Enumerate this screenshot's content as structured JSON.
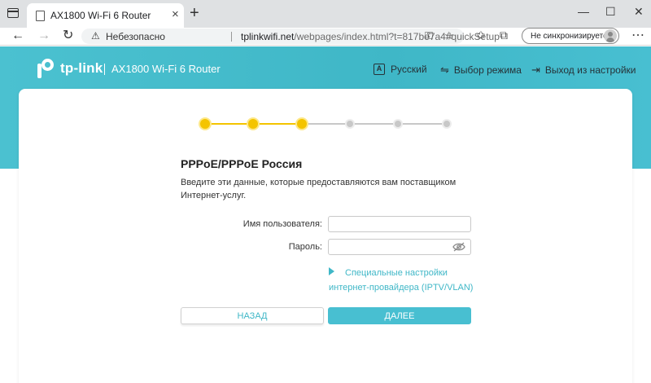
{
  "browser": {
    "tab_title": "AX1800 Wi-Fi 6 Router",
    "tab_close": "×",
    "new_tab": "+",
    "win_min": "—",
    "win_max": "☐",
    "win_close": "✕",
    "back": "←",
    "forward": "→",
    "reload": "↻",
    "security_text": "Небезопасно",
    "url_host": "tplinkwifi.net",
    "url_path": "/webpages/index.html?t=817be7a4#quickSetup",
    "sync_label": "Не синхронизируется",
    "more": "⋯"
  },
  "header": {
    "logo_text": "tp-link",
    "separator": "|",
    "product": "AX1800 Wi-Fi 6 Router",
    "language": "Русский",
    "language_icon_letter": "A",
    "mode": "Выбор режима",
    "logout": "Выход из настройки"
  },
  "progress": {
    "total_steps": 6,
    "completed_steps": 3,
    "done_color": "#f4c400",
    "todo_color": "#c8c8c8"
  },
  "form": {
    "title": "PPPoE/PPPoE Россия",
    "description": "Введите эти данные, которые предоставляются вам поставщиком Интернет-услуг.",
    "username_label": "Имя пользователя:",
    "username_value": "",
    "password_label": "Пароль:",
    "password_value": "",
    "advanced_line1": "Специальные настройки",
    "advanced_line2": "интернет-провайдера (IPTV/VLAN)",
    "back_button": "НАЗАД",
    "next_button": "ДАЛЕЕ"
  },
  "colors": {
    "accent": "#48bfd1",
    "banner": "#3fb7c7"
  }
}
